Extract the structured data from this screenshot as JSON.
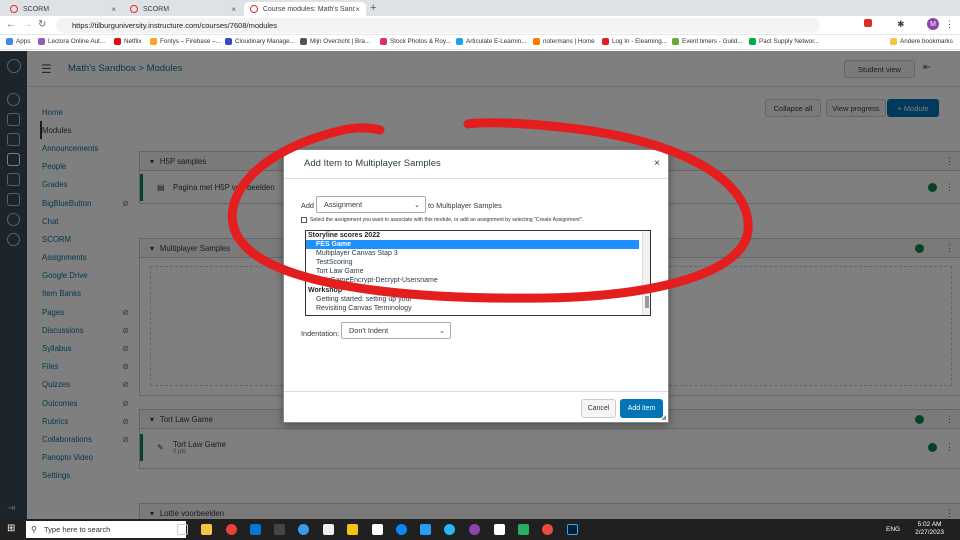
{
  "browser": {
    "tabs": [
      {
        "title": "SCORM"
      },
      {
        "title": "SCORM"
      },
      {
        "title": "Course modules: Math's Sandbox"
      }
    ],
    "url": "https://tilburguniversity.instructure.com/courses/7608/modules",
    "bookmarks": [
      "Apps",
      "Lectora Online Aut...",
      "Netflix",
      "Fontys – Firebase –...",
      "Cloudinary Manage...",
      "Mijn Overzicht | Bra...",
      "Stock Photos & Roy...",
      "Articulate E-Learnin...",
      "notermans | Home",
      "Log In - Elearning...",
      "Event timers - Guild...",
      "Pact Supply Networ...",
      "Andere bookmarks"
    ]
  },
  "header": {
    "breadcrumb": "Math's Sandbox > Modules",
    "student_view": "Student view"
  },
  "course_nav": [
    {
      "label": "Home",
      "hidden": false
    },
    {
      "label": "Modules",
      "hidden": false,
      "active": true
    },
    {
      "label": "Announcements",
      "hidden": false
    },
    {
      "label": "People",
      "hidden": false
    },
    {
      "label": "Grades",
      "hidden": false
    },
    {
      "label": "BigBlueButton",
      "hidden": true
    },
    {
      "label": "Chat",
      "hidden": false
    },
    {
      "label": "SCORM",
      "hidden": false
    },
    {
      "label": "Assignments",
      "hidden": false
    },
    {
      "label": "Google Drive",
      "hidden": false
    },
    {
      "label": "Item Banks",
      "hidden": false
    },
    {
      "label": "Pages",
      "hidden": true
    },
    {
      "label": "Discussions",
      "hidden": true
    },
    {
      "label": "Syllabus",
      "hidden": true
    },
    {
      "label": "Files",
      "hidden": true
    },
    {
      "label": "Quizzes",
      "hidden": true
    },
    {
      "label": "Outcomes",
      "hidden": true
    },
    {
      "label": "Rubrics",
      "hidden": true
    },
    {
      "label": "Collaborations",
      "hidden": true
    },
    {
      "label": "Panopto Video",
      "hidden": false
    },
    {
      "label": "Settings",
      "hidden": false
    }
  ],
  "toolbar": {
    "collapse_all": "Collapse all",
    "view_progress": "View progress",
    "add_module": "+ Module"
  },
  "modules": [
    {
      "name": "H5P samples",
      "items": [
        {
          "title": "Pagina met H5P voorbeelden",
          "sub": ""
        }
      ]
    },
    {
      "name": "Multiplayer Samples",
      "items": []
    },
    {
      "name": "Tort Law Game",
      "items": [
        {
          "title": "Tort Law Game",
          "sub": "0 pts"
        }
      ]
    },
    {
      "name": "Lottie voorbeelden",
      "items": []
    }
  ],
  "dialog": {
    "title": "Add Item to Multiplayer Samples",
    "add_label": "Add",
    "type_value": "Assignment",
    "to_label": "to Multiplayer Samples",
    "hint": "Select the assignment you want to associate with this module, or add an assignment by selecting \"Create Assignment\".",
    "options": [
      {
        "text": "Storyline scores 2022",
        "kind": "group"
      },
      {
        "text": "FES Game",
        "kind": "selected"
      },
      {
        "text": "Multiplayer Canvas Stap 3",
        "kind": "item"
      },
      {
        "text": "TestScoring",
        "kind": "item"
      },
      {
        "text": "Tort Law Game",
        "kind": "item"
      },
      {
        "text": "QuizGameEncrypt-Decrypt-Usersname",
        "kind": "item"
      },
      {
        "text": "Workshop",
        "kind": "group"
      },
      {
        "text": "Getting started: setting up your",
        "kind": "item"
      },
      {
        "text": "Revisiting Canvas Terminology",
        "kind": "item"
      }
    ],
    "indentation_label": "Indentation:",
    "indentation_value": "Don't Indent",
    "cancel": "Cancel",
    "add_item": "Add item"
  },
  "taskbar": {
    "search_placeholder": "Type here to search",
    "lang": "ENG",
    "time": "5:02 AM",
    "date": "2/27/2023"
  },
  "colors": {
    "accent": "#0374b5",
    "annotation": "#e41e1e",
    "publish": "#0b874b"
  }
}
